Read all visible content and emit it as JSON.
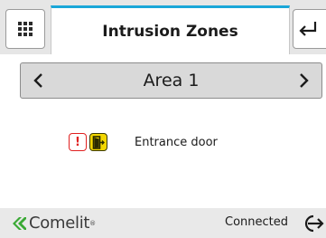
{
  "header": {
    "title": "Intrusion Zones",
    "menu_icon": "grid-menu-icon",
    "back_icon": "return-arrow-icon",
    "accent_color": "#1aa6d8"
  },
  "area_selector": {
    "current_area": "Area 1",
    "prev_icon": "chevron-left-icon",
    "next_icon": "chevron-right-icon"
  },
  "zones": [
    {
      "label": "Entrance door",
      "alarm_icon": "alarm-exclamation-icon",
      "alarm_symbol": "!",
      "type_icon": "door-icon",
      "alarm_color": "#e02020",
      "door_color": "#f2d600"
    }
  ],
  "footer": {
    "brand": "Comelit",
    "status": "Connected",
    "logout_icon": "logout-arrow-icon"
  }
}
